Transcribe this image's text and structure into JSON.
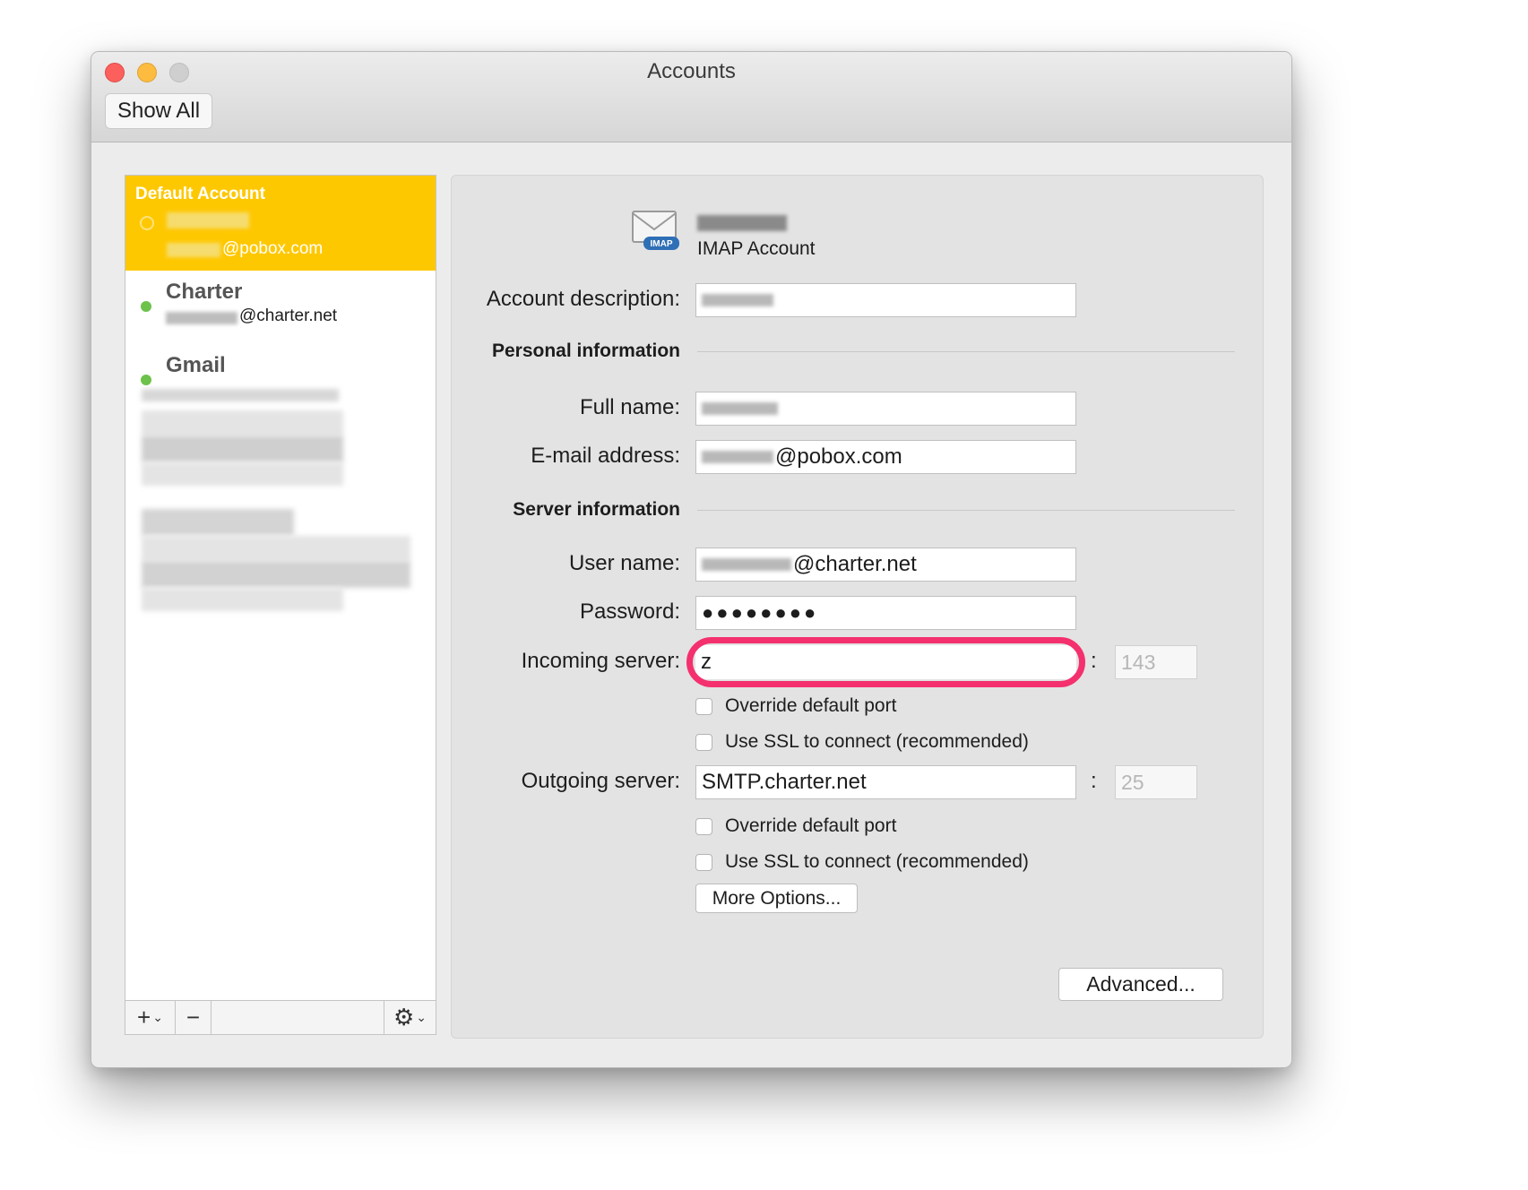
{
  "window": {
    "title": "Accounts",
    "show_all_label": "Show All"
  },
  "sidebar": {
    "default_header": "Default Account",
    "default_email_suffix": "@pobox.com",
    "accounts": [
      {
        "name": "Charter",
        "email_suffix": "@charter.net",
        "status": "green"
      },
      {
        "name": "Gmail",
        "status": "green"
      }
    ],
    "toolbar": {
      "add_icon": "plus-icon",
      "remove_icon": "minus-icon",
      "gear_icon": "gear-icon"
    }
  },
  "detail": {
    "account_type": "IMAP Account",
    "icon": "imap-envelope-icon",
    "icon_badge": "IMAP",
    "labels": {
      "account_description": "Account description:",
      "personal_information": "Personal information",
      "full_name": "Full name:",
      "email_address": "E-mail address:",
      "server_information": "Server information",
      "user_name": "User name:",
      "password": "Password:",
      "incoming_server": "Incoming server:",
      "outgoing_server": "Outgoing server:"
    },
    "values": {
      "email_suffix": "@pobox.com",
      "user_name_suffix": "@charter.net",
      "password_mask": "●●●●●●●●",
      "incoming_server": "z",
      "incoming_port_placeholder": "143",
      "outgoing_server": "SMTP.charter.net",
      "outgoing_port_placeholder": "25"
    },
    "colon": ":",
    "checkboxes": {
      "override_default_port": "Override default port",
      "use_ssl": "Use SSL to connect (recommended)"
    },
    "buttons": {
      "more_options": "More Options...",
      "advanced": "Advanced..."
    },
    "highlight_color": "#f4306e"
  },
  "colors": {
    "default_account_bg": "#fec800",
    "status_green": "#6cc24a"
  }
}
